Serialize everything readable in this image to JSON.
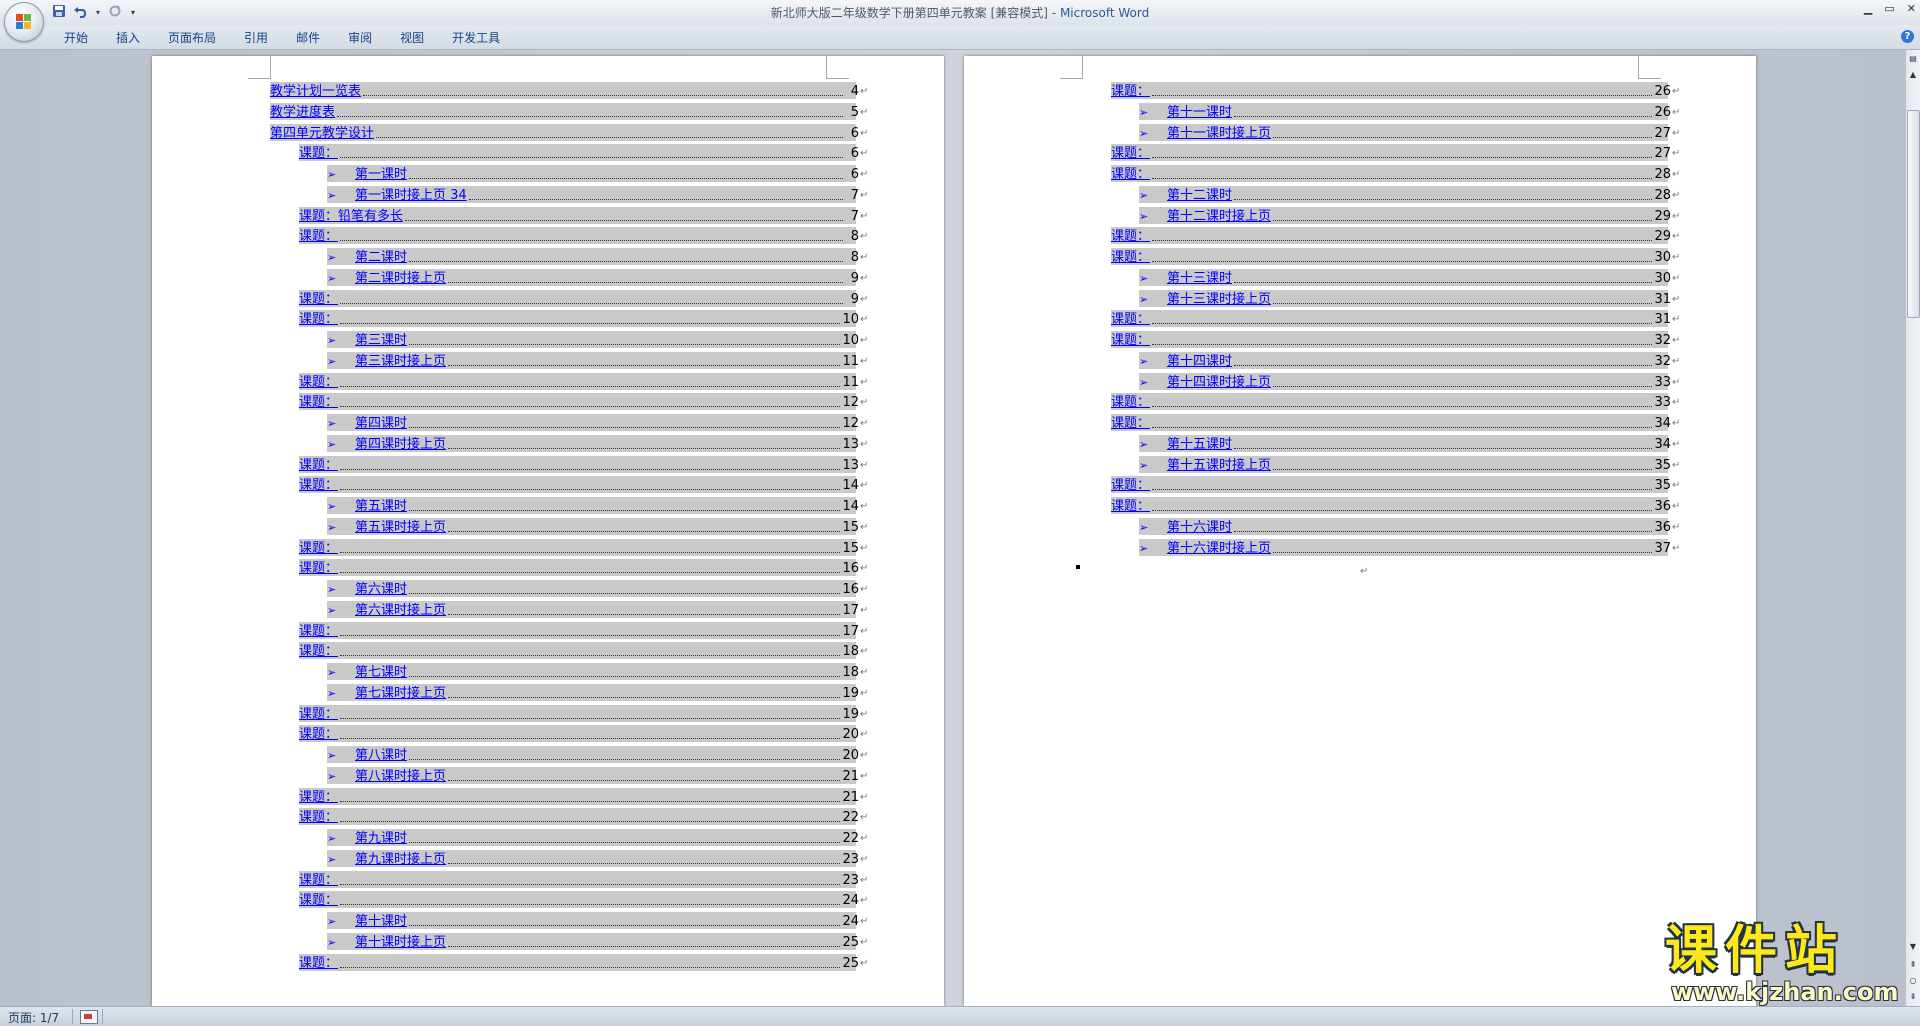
{
  "window": {
    "title": "新北师大版二年级数学下册第四单元教案 [兼容模式]",
    "title_separator": " - ",
    "app_name": "Microsoft Word"
  },
  "ribbon": {
    "tabs": [
      "开始",
      "插入",
      "页面布局",
      "引用",
      "邮件",
      "审阅",
      "视图",
      "开发工具"
    ]
  },
  "icons": {
    "office_button": "office-logo-icon",
    "save": "save-icon",
    "undo": "undo-icon",
    "redo": "redo-icon",
    "customize": "dropdown-icon",
    "help": "help-icon"
  },
  "pages": {
    "left": {
      "toc": [
        {
          "level": 1,
          "bullet": "",
          "label": "教学计划一览表",
          "page": "4"
        },
        {
          "level": 1,
          "bullet": "",
          "label": "教学进度表",
          "page": "5"
        },
        {
          "level": 1,
          "bullet": "",
          "label": "第四单元教学设计",
          "page": "6"
        },
        {
          "level": 2,
          "bullet": "",
          "label": "课题：",
          "page": "6"
        },
        {
          "level": 3,
          "bullet": "➢",
          "label": "第一课时",
          "page": "6"
        },
        {
          "level": 3,
          "bullet": "➢",
          "label": "第一课时接上页 34",
          "page": "7"
        },
        {
          "level": 2,
          "bullet": "",
          "label": "课题：铅笔有多长",
          "page": "7"
        },
        {
          "level": 2,
          "bullet": "",
          "label": "课题：",
          "page": "8"
        },
        {
          "level": 3,
          "bullet": "➢",
          "label": "第二课时",
          "page": "8"
        },
        {
          "level": 3,
          "bullet": "➢",
          "label": "第二课时接上页",
          "page": "9"
        },
        {
          "level": 2,
          "bullet": "",
          "label": "课题：",
          "page": "9"
        },
        {
          "level": 2,
          "bullet": "",
          "label": "课题：",
          "page": "10"
        },
        {
          "level": 3,
          "bullet": "➢",
          "label": "第三课时",
          "page": "10"
        },
        {
          "level": 3,
          "bullet": "➢",
          "label": "第三课时接上页",
          "page": "11"
        },
        {
          "level": 2,
          "bullet": "",
          "label": "课题：",
          "page": "11"
        },
        {
          "level": 2,
          "bullet": "",
          "label": "课题：",
          "page": "12"
        },
        {
          "level": 3,
          "bullet": "➢",
          "label": "第四课时",
          "page": "12"
        },
        {
          "level": 3,
          "bullet": "➢",
          "label": "第四课时接上页",
          "page": "13"
        },
        {
          "level": 2,
          "bullet": "",
          "label": "课题：",
          "page": "13"
        },
        {
          "level": 2,
          "bullet": "",
          "label": "课题：",
          "page": "14"
        },
        {
          "level": 3,
          "bullet": "➢",
          "label": "第五课时",
          "page": "14"
        },
        {
          "level": 3,
          "bullet": "➢",
          "label": "第五课时接上页",
          "page": "15"
        },
        {
          "level": 2,
          "bullet": "",
          "label": "课题：",
          "page": "15"
        },
        {
          "level": 2,
          "bullet": "",
          "label": "课题：",
          "page": "16"
        },
        {
          "level": 3,
          "bullet": "➢",
          "label": "第六课时",
          "page": "16"
        },
        {
          "level": 3,
          "bullet": "➢",
          "label": "第六课时接上页",
          "page": "17"
        },
        {
          "level": 2,
          "bullet": "",
          "label": "课题：",
          "page": "17"
        },
        {
          "level": 2,
          "bullet": "",
          "label": "课题：",
          "page": "18"
        },
        {
          "level": 3,
          "bullet": "➢",
          "label": "第七课时",
          "page": "18"
        },
        {
          "level": 3,
          "bullet": "➢",
          "label": "第七课时接上页",
          "page": "19"
        },
        {
          "level": 2,
          "bullet": "",
          "label": "课题：",
          "page": "19"
        },
        {
          "level": 2,
          "bullet": "",
          "label": "课题：",
          "page": "20"
        },
        {
          "level": 3,
          "bullet": "➢",
          "label": "第八课时",
          "page": "20"
        },
        {
          "level": 3,
          "bullet": "➢",
          "label": "第八课时接上页",
          "page": "21"
        },
        {
          "level": 2,
          "bullet": "",
          "label": "课题：",
          "page": "21"
        },
        {
          "level": 2,
          "bullet": "",
          "label": "课题：",
          "page": "22"
        },
        {
          "level": 3,
          "bullet": "➢",
          "label": "第九课时",
          "page": "22"
        },
        {
          "level": 3,
          "bullet": "➢",
          "label": "第九课时接上页",
          "page": "23"
        },
        {
          "level": 2,
          "bullet": "",
          "label": "课题：",
          "page": "23"
        },
        {
          "level": 2,
          "bullet": "",
          "label": "课题：",
          "page": "24"
        },
        {
          "level": 3,
          "bullet": "➢",
          "label": "第十课时",
          "page": "24"
        },
        {
          "level": 3,
          "bullet": "➢",
          "label": "第十课时接上页",
          "page": "25"
        },
        {
          "level": 2,
          "bullet": "",
          "label": "课题：",
          "page": "25"
        }
      ]
    },
    "right": {
      "toc": [
        {
          "level": 2,
          "bullet": "",
          "label": "课题：",
          "page": "26"
        },
        {
          "level": 3,
          "bullet": "➢",
          "label": "第十一课时",
          "page": "26"
        },
        {
          "level": 3,
          "bullet": "➢",
          "label": "第十一课时接上页",
          "page": "27"
        },
        {
          "level": 2,
          "bullet": "",
          "label": "课题：",
          "page": "27"
        },
        {
          "level": 2,
          "bullet": "",
          "label": "课题：",
          "page": "28"
        },
        {
          "level": 3,
          "bullet": "➢",
          "label": "第十二课时",
          "page": "28"
        },
        {
          "level": 3,
          "bullet": "➢",
          "label": "第十二课时接上页",
          "page": "29"
        },
        {
          "level": 2,
          "bullet": "",
          "label": "课题：",
          "page": "29"
        },
        {
          "level": 2,
          "bullet": "",
          "label": "课题：",
          "page": "30"
        },
        {
          "level": 3,
          "bullet": "➢",
          "label": "第十三课时",
          "page": "30"
        },
        {
          "level": 3,
          "bullet": "➢",
          "label": "第十三课时接上页",
          "page": "31"
        },
        {
          "level": 2,
          "bullet": "",
          "label": "课题：",
          "page": "31"
        },
        {
          "level": 2,
          "bullet": "",
          "label": "课题：",
          "page": "32"
        },
        {
          "level": 3,
          "bullet": "➢",
          "label": "第十四课时",
          "page": "32"
        },
        {
          "level": 3,
          "bullet": "➢",
          "label": "第十四课时接上页",
          "page": "33"
        },
        {
          "level": 2,
          "bullet": "",
          "label": "课题：",
          "page": "33"
        },
        {
          "level": 2,
          "bullet": "",
          "label": "课题：",
          "page": "34"
        },
        {
          "level": 3,
          "bullet": "➢",
          "label": "第十五课时",
          "page": "34"
        },
        {
          "level": 3,
          "bullet": "➢",
          "label": "第十五课时接上页",
          "page": "35"
        },
        {
          "level": 2,
          "bullet": "",
          "label": "课题：",
          "page": "35"
        },
        {
          "level": 2,
          "bullet": "",
          "label": "课题：",
          "page": "36"
        },
        {
          "level": 3,
          "bullet": "➢",
          "label": "第十六课时",
          "page": "36"
        },
        {
          "level": 3,
          "bullet": "➢",
          "label": "第十六课时接上页",
          "page": "37"
        }
      ]
    }
  },
  "paragraph_mark": "↵",
  "statusbar": {
    "page_indicator": "页面: 1/7"
  },
  "watermark": {
    "main": "课件站",
    "url": "www.kjzhan.com"
  }
}
